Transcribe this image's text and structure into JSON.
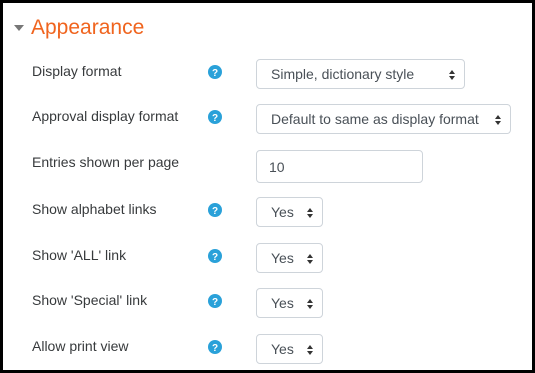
{
  "section": {
    "title": "Appearance",
    "collapse_icon": "triangle-down-icon"
  },
  "fields": [
    {
      "label": "Display format",
      "help": true,
      "type": "select",
      "value": "Simple, dictionary style"
    },
    {
      "label": "Approval display format",
      "help": true,
      "type": "select",
      "value": "Default to same as display format"
    },
    {
      "label": "Entries shown per page",
      "help": false,
      "type": "text",
      "value": "10"
    },
    {
      "label": "Show alphabet links",
      "help": true,
      "type": "select",
      "value": "Yes"
    },
    {
      "label": "Show 'ALL' link",
      "help": true,
      "type": "select",
      "value": "Yes"
    },
    {
      "label": "Show 'Special' link",
      "help": true,
      "type": "select",
      "value": "Yes"
    },
    {
      "label": "Allow print view",
      "help": true,
      "type": "select",
      "value": "Yes"
    }
  ],
  "colors": {
    "accent": "#f0641e",
    "help_icon": "#2aa1d9",
    "text": "#373a3c",
    "border": "#ced4da"
  }
}
